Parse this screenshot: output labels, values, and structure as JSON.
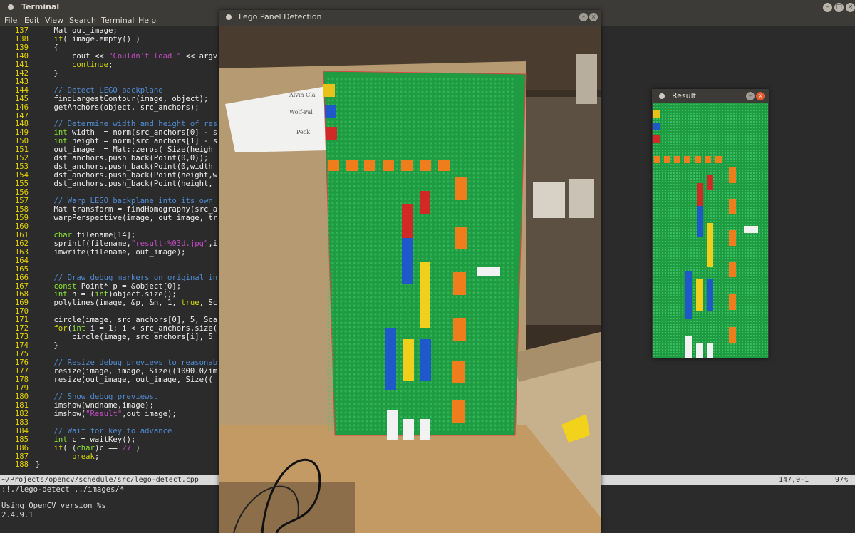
{
  "terminal": {
    "title": "Terminal",
    "menu": [
      "File",
      "Edit",
      "View",
      "Search",
      "Terminal",
      "Help"
    ],
    "code_lines": [
      {
        "n": "137",
        "t": [
          [
            "",
            "    Mat out_image;"
          ]
        ]
      },
      {
        "n": "138",
        "t": [
          [
            "kw",
            "    if"
          ],
          [
            "",
            "( image.empty() )"
          ]
        ]
      },
      {
        "n": "139",
        "t": [
          [
            "",
            "    {"
          ]
        ]
      },
      {
        "n": "140",
        "t": [
          [
            "",
            "        cout << "
          ],
          [
            "st",
            "\"Couldn't load \""
          ],
          [
            "",
            " << argv"
          ]
        ]
      },
      {
        "n": "141",
        "t": [
          [
            "kw",
            "        continue"
          ],
          [
            "",
            ";"
          ]
        ]
      },
      {
        "n": "142",
        "t": [
          [
            "",
            "    }"
          ]
        ]
      },
      {
        "n": "143",
        "t": [
          [
            "",
            ""
          ]
        ]
      },
      {
        "n": "144",
        "t": [
          [
            "cm",
            "    // Detect LEGO backplane"
          ]
        ]
      },
      {
        "n": "145",
        "t": [
          [
            "",
            "    findLargestContour(image, object);"
          ]
        ]
      },
      {
        "n": "146",
        "t": [
          [
            "",
            "    getAnchors(object, src_anchors);"
          ]
        ]
      },
      {
        "n": "147",
        "t": [
          [
            "",
            ""
          ]
        ]
      },
      {
        "n": "148",
        "t": [
          [
            "cm",
            "    // Determine width and height of res"
          ]
        ]
      },
      {
        "n": "149",
        "t": [
          [
            "ty",
            "    int"
          ],
          [
            "",
            " width  = norm(src_anchors[0] - s"
          ]
        ]
      },
      {
        "n": "150",
        "t": [
          [
            "ty",
            "    int"
          ],
          [
            "",
            " height = norm(src_anchors[1] - s"
          ]
        ]
      },
      {
        "n": "151",
        "t": [
          [
            "",
            "    out_image  = Mat::zeros( Size(heigh"
          ]
        ]
      },
      {
        "n": "152",
        "t": [
          [
            "",
            "    dst_anchors.push_back(Point(0,0));"
          ]
        ]
      },
      {
        "n": "153",
        "t": [
          [
            "",
            "    dst_anchors.push_back(Point(0,width"
          ]
        ]
      },
      {
        "n": "154",
        "t": [
          [
            "",
            "    dst_anchors.push_back(Point(height,w"
          ]
        ]
      },
      {
        "n": "155",
        "t": [
          [
            "",
            "    dst_anchors.push_back(Point(height,"
          ]
        ]
      },
      {
        "n": "156",
        "t": [
          [
            "",
            ""
          ]
        ]
      },
      {
        "n": "157",
        "t": [
          [
            "cm",
            "    // Warp LEGO backplane into its own"
          ]
        ]
      },
      {
        "n": "158",
        "t": [
          [
            "",
            "    Mat transform = findHomography(src_a"
          ]
        ]
      },
      {
        "n": "159",
        "t": [
          [
            "",
            "    warpPerspective(image, out_image, tr"
          ]
        ]
      },
      {
        "n": "160",
        "t": [
          [
            "",
            ""
          ]
        ]
      },
      {
        "n": "161",
        "t": [
          [
            "ty",
            "    char"
          ],
          [
            "",
            " filename[14];"
          ]
        ]
      },
      {
        "n": "162",
        "t": [
          [
            "",
            "    sprintf(filename,"
          ],
          [
            "st",
            "\"result-%03d.jpg\""
          ],
          [
            "",
            ",i"
          ]
        ]
      },
      {
        "n": "163",
        "t": [
          [
            "",
            "    imwrite(filename, out_image);"
          ]
        ]
      },
      {
        "n": "164",
        "t": [
          [
            "",
            ""
          ]
        ]
      },
      {
        "n": "165",
        "t": [
          [
            "",
            ""
          ]
        ]
      },
      {
        "n": "166",
        "t": [
          [
            "cm",
            "    // Draw debug markers on original in"
          ]
        ]
      },
      {
        "n": "167",
        "t": [
          [
            "ty",
            "    const"
          ],
          [
            "",
            " Point* p = &object[0];"
          ]
        ]
      },
      {
        "n": "168",
        "t": [
          [
            "ty",
            "    int"
          ],
          [
            "",
            " n = ("
          ],
          [
            "ty",
            "int"
          ],
          [
            "",
            ")object.size();"
          ]
        ]
      },
      {
        "n": "169",
        "t": [
          [
            "",
            "    polylines(image, &p, &n, 1, "
          ],
          [
            "kw",
            "true"
          ],
          [
            "",
            ", Sc"
          ]
        ]
      },
      {
        "n": "170",
        "t": [
          [
            "",
            ""
          ]
        ]
      },
      {
        "n": "171",
        "t": [
          [
            "",
            "    circle(image, src_anchors[0], 5, Sca"
          ]
        ]
      },
      {
        "n": "172",
        "t": [
          [
            "kw",
            "    for"
          ],
          [
            "",
            "("
          ],
          [
            "ty",
            "int"
          ],
          [
            "",
            " i = 1; i < src_anchors.size("
          ]
        ]
      },
      {
        "n": "173",
        "t": [
          [
            "",
            "        circle(image, src_anchors[i], 5"
          ]
        ]
      },
      {
        "n": "174",
        "t": [
          [
            "",
            "    }"
          ]
        ]
      },
      {
        "n": "175",
        "t": [
          [
            "",
            ""
          ]
        ]
      },
      {
        "n": "176",
        "t": [
          [
            "cm",
            "    // Resize debug previews to reasonab"
          ]
        ]
      },
      {
        "n": "177",
        "t": [
          [
            "",
            "    resize(image, image, Size((1000.0/im"
          ]
        ]
      },
      {
        "n": "178",
        "t": [
          [
            "",
            "    resize(out_image, out_image, Size(("
          ]
        ]
      },
      {
        "n": "179",
        "t": [
          [
            "",
            ""
          ]
        ]
      },
      {
        "n": "180",
        "t": [
          [
            "cm",
            "    // Show debug previews."
          ]
        ]
      },
      {
        "n": "181",
        "t": [
          [
            "",
            "    imshow(wndname,image);"
          ]
        ]
      },
      {
        "n": "182",
        "t": [
          [
            "",
            "    imshow("
          ],
          [
            "st",
            "\"Result\""
          ],
          [
            "",
            ",out_image);"
          ]
        ]
      },
      {
        "n": "183",
        "t": [
          [
            "",
            ""
          ]
        ]
      },
      {
        "n": "184",
        "t": [
          [
            "cm",
            "    // Wait for key to advance"
          ]
        ]
      },
      {
        "n": "185",
        "t": [
          [
            "ty",
            "    int"
          ],
          [
            "",
            " c = waitKey();"
          ]
        ]
      },
      {
        "n": "186",
        "t": [
          [
            "kw",
            "    if"
          ],
          [
            "",
            "( ("
          ],
          [
            "ty",
            "char"
          ],
          [
            "",
            ")c == "
          ],
          [
            "st",
            "27"
          ],
          [
            "",
            " )"
          ]
        ]
      },
      {
        "n": "187",
        "t": [
          [
            "kw",
            "        break"
          ],
          [
            "",
            ";"
          ]
        ]
      },
      {
        "n": "188",
        "t": [
          [
            "",
            "}"
          ]
        ]
      }
    ],
    "status_left": "~/Projects/opencv/schedule/src/lego-detect.cpp",
    "status_pos": "147,0-1",
    "status_pct": "97%",
    "output_lines": [
      ":!./lego-detect ../images/*",
      "",
      "Using OpenCV version %s",
      "2.4.9.1"
    ]
  },
  "detect_window": {
    "title": "Lego Panel Detection"
  },
  "result_window": {
    "title": "Result"
  },
  "sticky_note_lines": [
    "Alvin Cla",
    "Wolf-Pal",
    "Peck"
  ]
}
